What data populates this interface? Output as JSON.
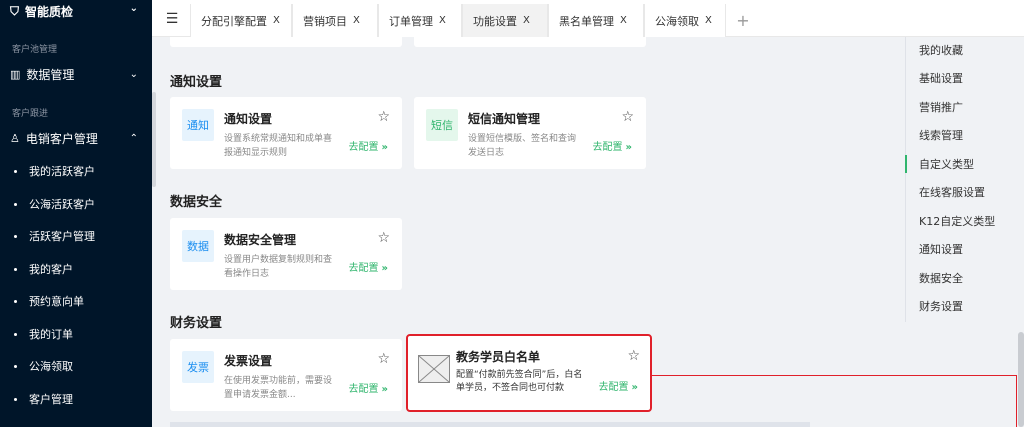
{
  "sidebar": {
    "top_item": {
      "label": "智能质检",
      "icon": "shield-check-icon"
    },
    "section_pool": "客户池管理",
    "data_mgmt": {
      "label": "数据管理",
      "icon": "chart-icon"
    },
    "section_follow": "客户跟进",
    "sales_group": {
      "label": "电销客户管理",
      "icon": "user-icon"
    },
    "sub_items": [
      "我的活跃客户",
      "公海活跃客户",
      "活跃客户管理",
      "我的客户",
      "预约意向单",
      "我的订单",
      "公海领取",
      "客户管理"
    ]
  },
  "tabs": {
    "items": [
      {
        "label": "分配引擎配置"
      },
      {
        "label": "营销项目"
      },
      {
        "label": "订单管理"
      },
      {
        "label": "功能设置",
        "active": true
      },
      {
        "label": "黑名单管理"
      },
      {
        "label": "公海领取"
      }
    ],
    "close_glyph": "X",
    "add_glyph": "+"
  },
  "sections": {
    "notify": "通知设置",
    "datasec": "数据安全",
    "finance": "财务设置"
  },
  "cards": {
    "notify": {
      "badge": "通知",
      "title": "通知设置",
      "desc": "设置系统常规通知和成单喜报通知显示规则",
      "go": "去配置"
    },
    "sms": {
      "badge": "短信",
      "title": "短信通知管理",
      "desc": "设置短信模版、签名和查询发送日志",
      "go": "去配置"
    },
    "datasec": {
      "badge": "数据",
      "title": "数据安全管理",
      "desc": "设置用户数据复制规则和查看操作日志",
      "go": "去配置"
    },
    "invoice": {
      "badge": "发票",
      "title": "发票设置",
      "desc": "在使用发票功能前，需要设置申请发票金额...",
      "go": "去配置"
    },
    "whitelist": {
      "title": "教务学员白名单",
      "desc": "配置“付款前先签合同”后，白名单学员，不签合同也可付款",
      "go": "去配置"
    }
  },
  "anchor_nav": {
    "items": [
      "我的收藏",
      "基础设置",
      "营销推广",
      "线索管理",
      "自定义类型",
      "在线客服设置",
      "K12自定义类型",
      "通知设置",
      "数据安全",
      "财务设置"
    ],
    "active_index": 4
  },
  "colors": {
    "accent": "#30b56d",
    "highlight": "#e0202a",
    "sidebar": "#001529",
    "badge_blue": "#1b8ef0"
  }
}
